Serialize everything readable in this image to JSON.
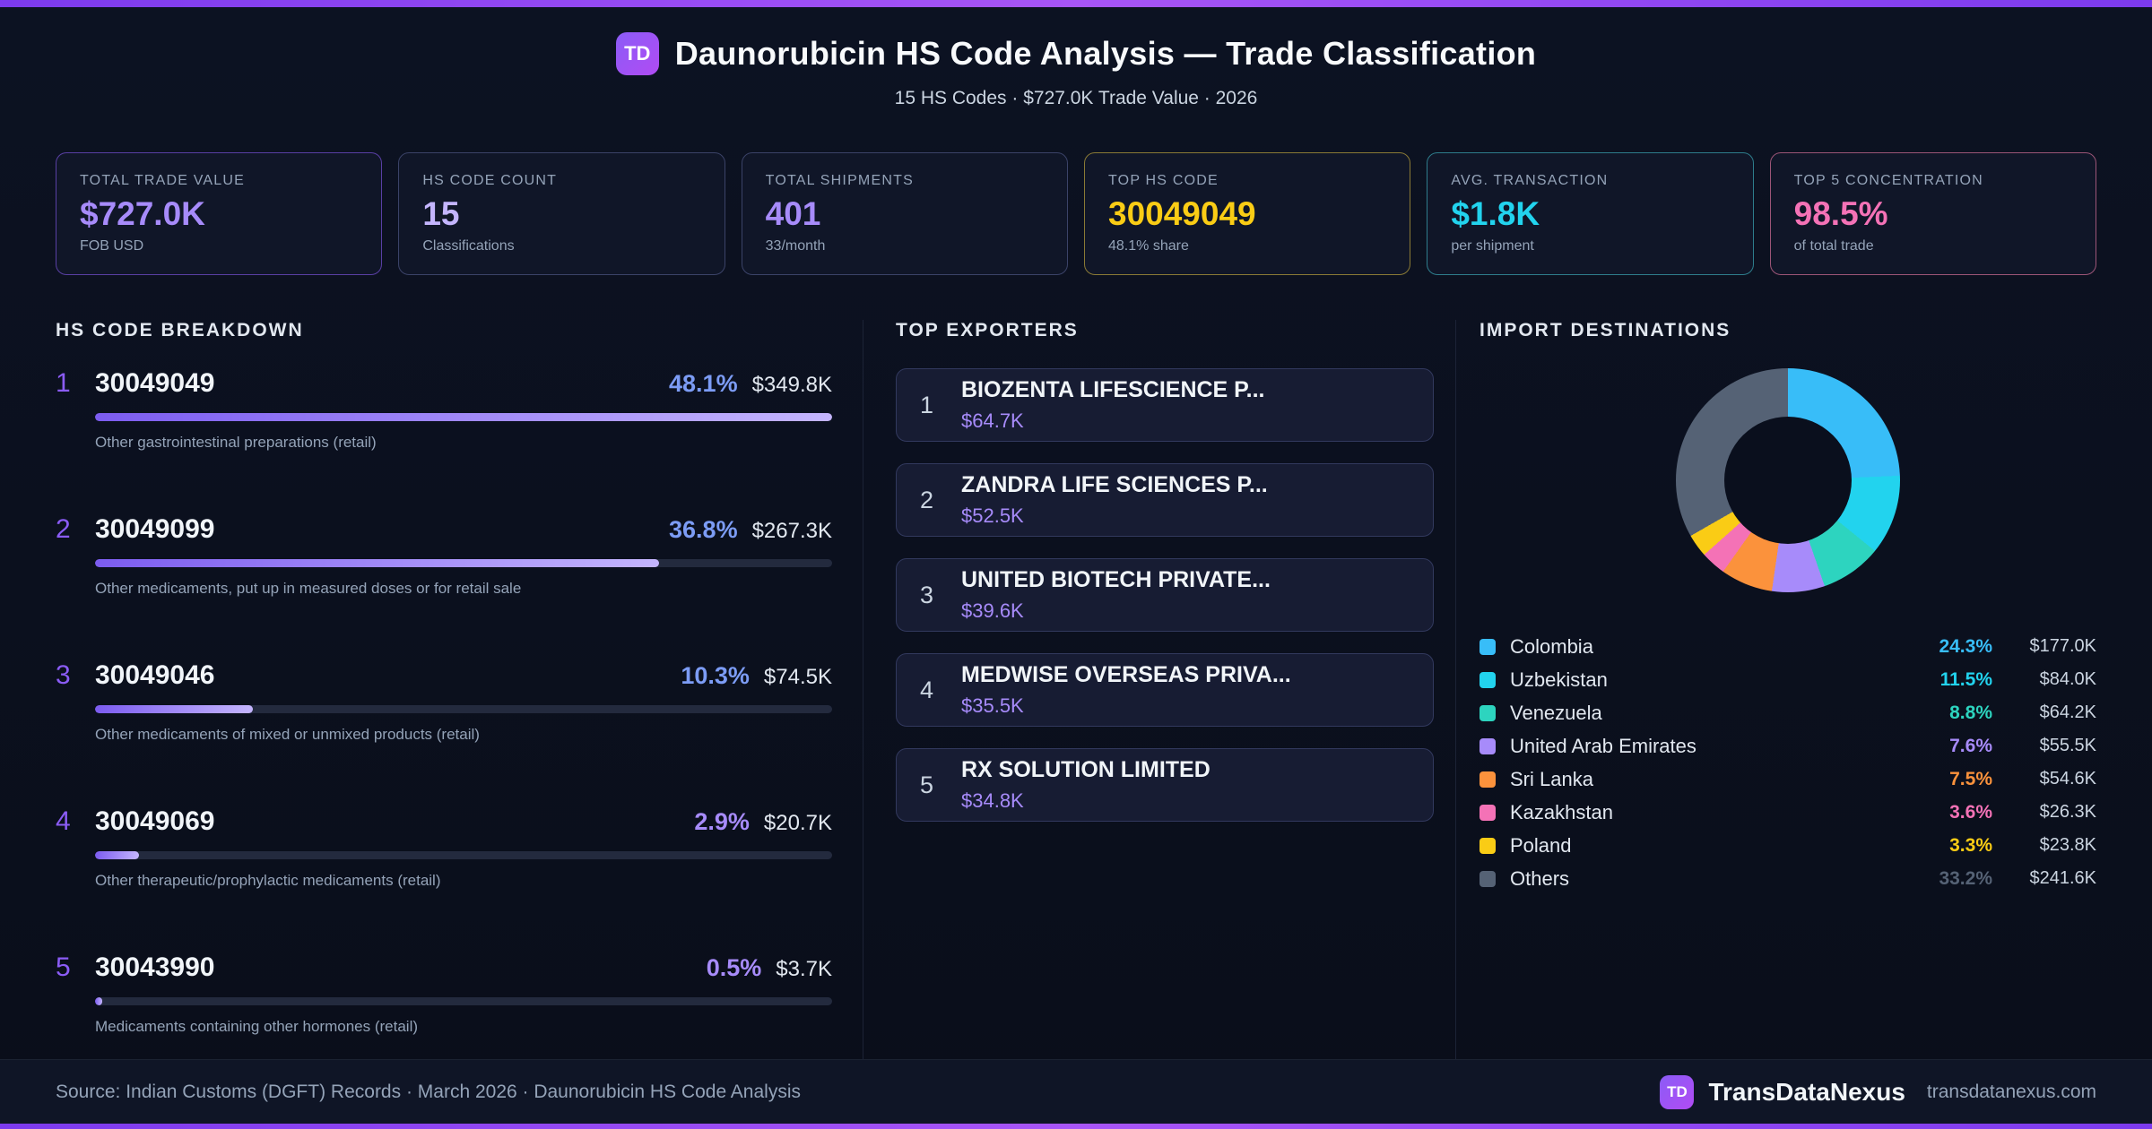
{
  "header": {
    "logo": "TD",
    "title": "Daunorubicin HS Code Analysis — Trade Classification",
    "subtitle": "15 HS Codes · $727.0K Trade Value · 2026"
  },
  "stats": [
    {
      "label": "TOTAL TRADE VALUE",
      "value": "$727.0K",
      "sub": "FOB USD",
      "color": "#a78bfa",
      "border": "#8b5cf699"
    },
    {
      "label": "HS CODE COUNT",
      "value": "15",
      "sub": "Classifications",
      "color": "#c4b5fd",
      "border": "#3b4368"
    },
    {
      "label": "TOTAL SHIPMENTS",
      "value": "401",
      "sub": "33/month",
      "color": "#a78bfa",
      "border": "#3b4368"
    },
    {
      "label": "TOP HS CODE",
      "value": "30049049",
      "sub": "48.1% share",
      "color": "#facc15",
      "border": "#8a7a35"
    },
    {
      "label": "AVG. TRANSACTION",
      "value": "$1.8K",
      "sub": "per shipment",
      "color": "#22d3ee",
      "border": "#2e7d8c"
    },
    {
      "label": "TOP 5 CONCENTRATION",
      "value": "98.5%",
      "sub": "of total trade",
      "color": "#f472b6",
      "border": "#9c5577"
    }
  ],
  "breakdown": {
    "title": "HS CODE BREAKDOWN",
    "items": [
      {
        "rank": "1",
        "code": "30049049",
        "pct": "48.1%",
        "pct_color": "#7c9cf5",
        "value": "$349.8K",
        "bar_pct": 100,
        "desc": "Other gastrointestinal preparations (retail)"
      },
      {
        "rank": "2",
        "code": "30049099",
        "pct": "36.8%",
        "pct_color": "#7c9cf5",
        "value": "$267.3K",
        "bar_pct": 76.5,
        "desc": "Other medicaments, put up in measured doses or for retail sale"
      },
      {
        "rank": "3",
        "code": "30049046",
        "pct": "10.3%",
        "pct_color": "#7c9cf5",
        "value": "$74.5K",
        "bar_pct": 21.4,
        "desc": "Other medicaments of mixed or unmixed products (retail)"
      },
      {
        "rank": "4",
        "code": "30049069",
        "pct": "2.9%",
        "pct_color": "#a78bfa",
        "value": "$20.7K",
        "bar_pct": 6,
        "desc": "Other therapeutic/prophylactic medicaments (retail)"
      },
      {
        "rank": "5",
        "code": "30043990",
        "pct": "0.5%",
        "pct_color": "#a78bfa",
        "value": "$3.7K",
        "bar_pct": 1,
        "desc": "Medicaments containing other hormones (retail)"
      }
    ]
  },
  "exporters": {
    "title": "TOP EXPORTERS",
    "items": [
      {
        "rank": "1",
        "name": "BIOZENTA LIFESCIENCE P...",
        "value": "$64.7K"
      },
      {
        "rank": "2",
        "name": "ZANDRA LIFE SCIENCES P...",
        "value": "$52.5K"
      },
      {
        "rank": "3",
        "name": "UNITED BIOTECH PRIVATE...",
        "value": "$39.6K"
      },
      {
        "rank": "4",
        "name": "MEDWISE OVERSEAS PRIVA...",
        "value": "$35.5K"
      },
      {
        "rank": "5",
        "name": "RX SOLUTION LIMITED",
        "value": "$34.8K"
      }
    ]
  },
  "destinations": {
    "title": "IMPORT DESTINATIONS",
    "legend": [
      {
        "name": "Colombia",
        "pct": "24.3%",
        "amount": "$177.0K"
      },
      {
        "name": "Uzbekistan",
        "pct": "11.5%",
        "amount": "$84.0K"
      },
      {
        "name": "Venezuela",
        "pct": "8.8%",
        "amount": "$64.2K"
      },
      {
        "name": "United Arab Emirates",
        "pct": "7.6%",
        "amount": "$55.5K"
      },
      {
        "name": "Sri Lanka",
        "pct": "7.5%",
        "amount": "$54.6K"
      },
      {
        "name": "Kazakhstan",
        "pct": "3.6%",
        "amount": "$26.3K"
      },
      {
        "name": "Poland",
        "pct": "3.3%",
        "amount": "$23.8K"
      },
      {
        "name": "Others",
        "pct": "33.2%",
        "amount": "$241.6K"
      }
    ]
  },
  "chart_data": {
    "type": "pie",
    "title": "IMPORT DESTINATIONS",
    "donut": true,
    "legend_position": "bottom",
    "categories": [
      "Colombia",
      "Uzbekistan",
      "Venezuela",
      "United Arab Emirates",
      "Sri Lanka",
      "Kazakhstan",
      "Poland",
      "Others"
    ],
    "values": [
      24.3,
      11.5,
      8.8,
      7.6,
      7.5,
      3.6,
      3.3,
      33.2
    ],
    "amounts": [
      "$177.0K",
      "$84.0K",
      "$64.2K",
      "$55.5K",
      "$54.6K",
      "$26.3K",
      "$23.8K",
      "$241.6K"
    ],
    "colors": [
      "#38bdf8",
      "#22d3ee",
      "#2dd4bf",
      "#a78bfa",
      "#fb923c",
      "#f472b6",
      "#facc15",
      "#556275"
    ]
  },
  "footer": {
    "source": "Source: Indian Customs (DGFT) Records · March 2026 · Daunorubicin HS Code Analysis",
    "logo": "TD",
    "brand": "TransDataNexus",
    "domain": "transdatanexus.com"
  }
}
